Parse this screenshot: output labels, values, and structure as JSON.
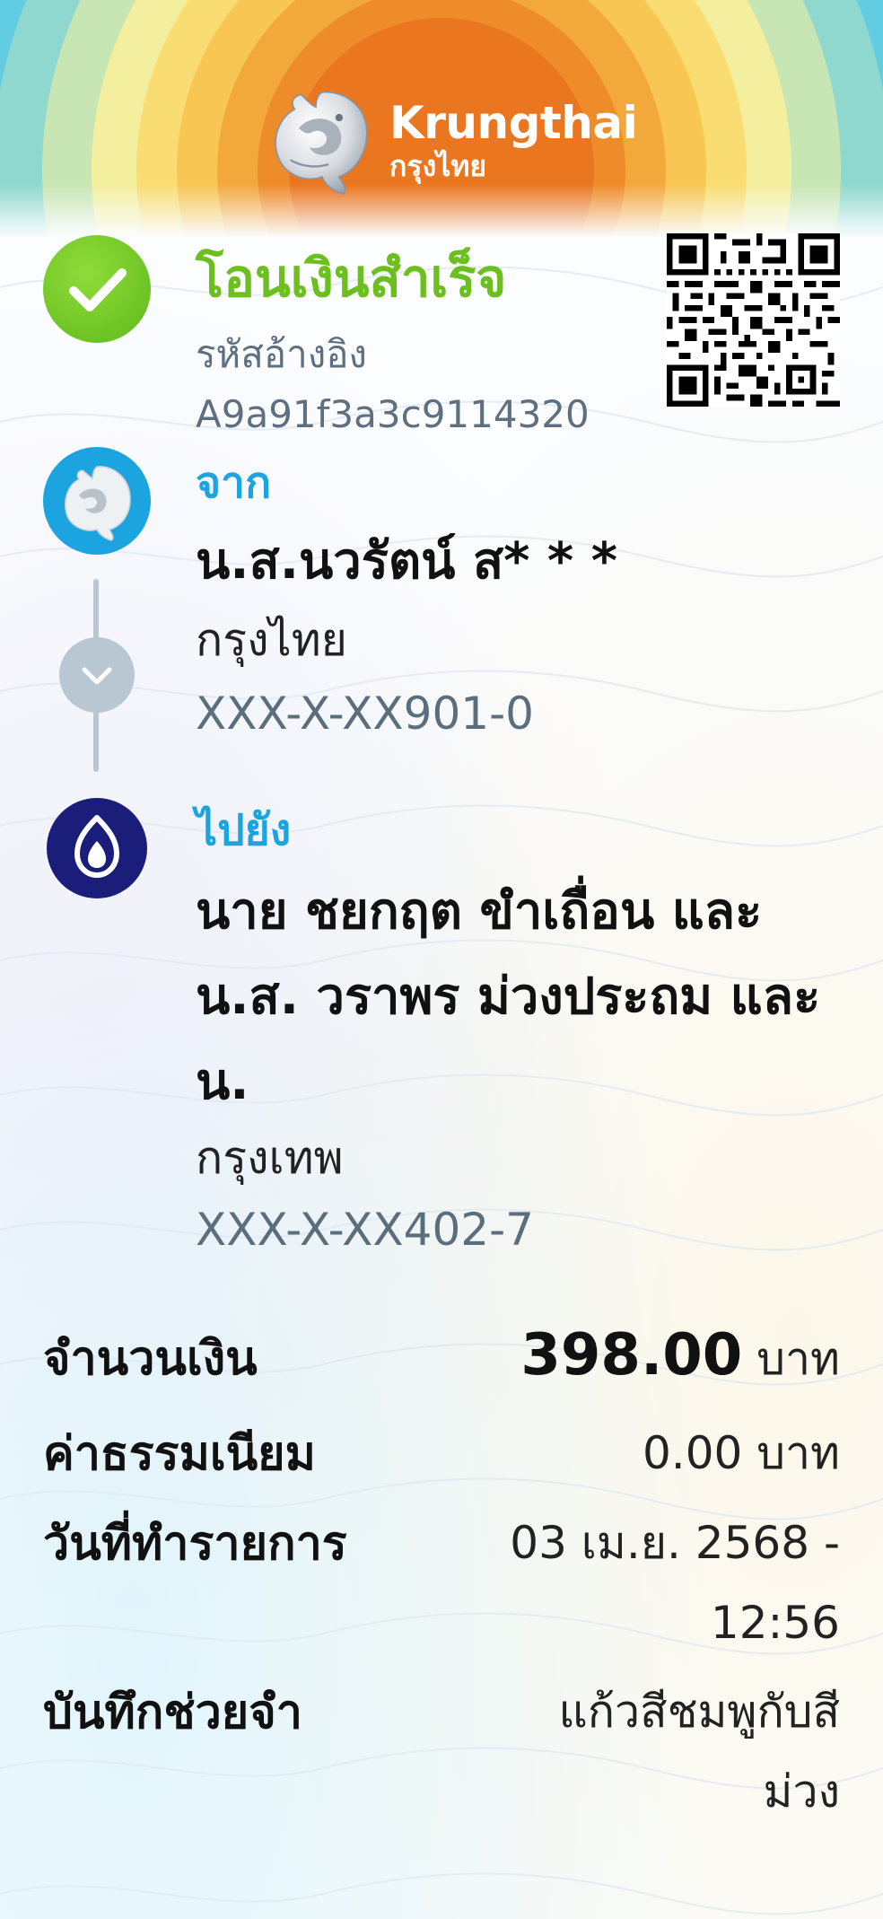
{
  "brand": {
    "name_en": "Krungthai",
    "name_th": "กรุงไทย",
    "color_orange": "#ee7a1e",
    "color_success": "#6cbf1e",
    "color_blue": "#1ba4e0"
  },
  "status": {
    "title": "โอนเงินสำเร็จ",
    "ref_label": "รหัสอ้างอิง",
    "ref_code": "A9a91f3a3c9114320"
  },
  "from": {
    "label": "จาก",
    "name": "น.ส.นวรัตน์ ส* * *",
    "bank": "กรุงไทย",
    "account": "XXX-X-XX901-0",
    "icon": "krungthai-bird-icon"
  },
  "to": {
    "label": "ไปยัง",
    "name_line1": "นาย ชยกฤต ขำเถื่อน และ",
    "name_line2": "น.ส. วราพร ม่วงประถม และ",
    "name_line3": "น.",
    "bank": "กรุงเทพ",
    "account": "XXX-X-XX402-7",
    "icon": "bangkok-bank-lotus-icon"
  },
  "details": {
    "amount_label": "จำนวนเงิน",
    "amount_value": "398.00",
    "amount_unit": "บาท",
    "fee_label": "ค่าธรรมเนียม",
    "fee_value": "0.00 บาท",
    "date_label": "วันที่ทำรายการ",
    "date_line1": "03 เม.ย. 2568 -",
    "date_line2": "12:56",
    "memo_label": "บันทึกช่วยจำ",
    "memo_line1": "แก้วสีชมพูกับสี",
    "memo_line2": "ม่วง"
  }
}
